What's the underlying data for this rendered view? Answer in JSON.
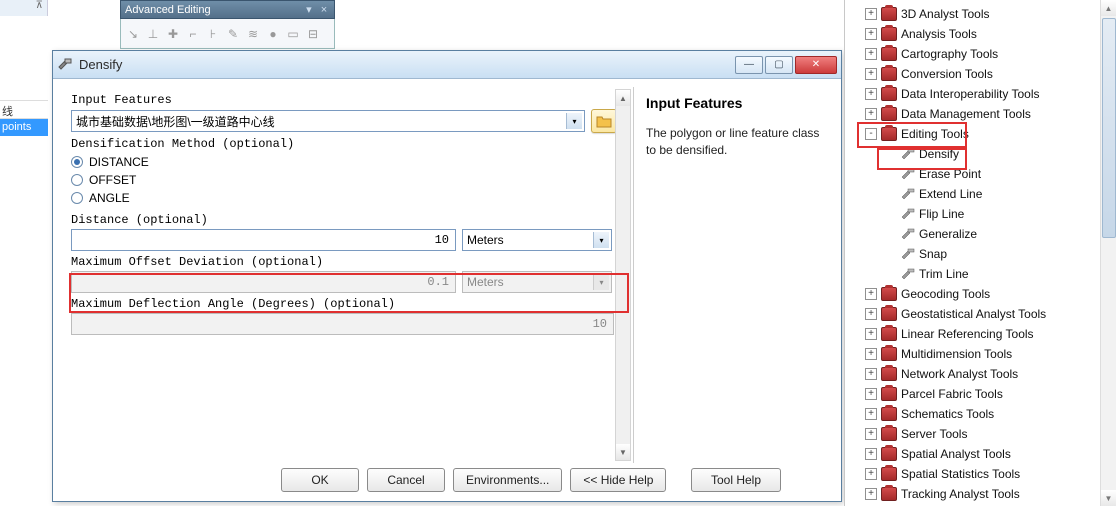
{
  "frag_top": {
    "pin": "⊼"
  },
  "adv_toolbar": {
    "title": "Advanced Editing",
    "dropdown": "▾",
    "close": "×"
  },
  "left_strip": {
    "item1": "线",
    "item2": "points"
  },
  "dialog": {
    "title": "Densify",
    "min": "—",
    "max": "▢",
    "close": "✕",
    "labels": {
      "input_features": "Input Features",
      "method": "Densification Method (optional)",
      "distance": "Distance (optional)",
      "offset": "Maximum Offset Deviation (optional)",
      "angle": "Maximum Deflection Angle (Degrees) (optional)"
    },
    "features_value": "城市基础数据\\地形图\\一级道路中心线",
    "radios": {
      "distance": "DISTANCE",
      "offset": "OFFSET",
      "angle": "ANGLE"
    },
    "values": {
      "distance": "10",
      "distance_unit": "Meters",
      "offset": "0.1",
      "offset_unit": "Meters",
      "angle": "10"
    },
    "buttons": {
      "ok": "OK",
      "cancel": "Cancel",
      "env": "Environments...",
      "hide": "<< Hide Help",
      "toolhelp": "Tool Help"
    },
    "help": {
      "title": "Input Features",
      "body": "The polygon or line feature class to be densified."
    },
    "arrow": "▾",
    "scroll_up": "▲",
    "scroll_down": "▼"
  },
  "tree": {
    "items": [
      {
        "level": 1,
        "exp": "+",
        "type": "box",
        "label": "3D Analyst Tools"
      },
      {
        "level": 1,
        "exp": "+",
        "type": "box",
        "label": "Analysis Tools"
      },
      {
        "level": 1,
        "exp": "+",
        "type": "box",
        "label": "Cartography Tools"
      },
      {
        "level": 1,
        "exp": "+",
        "type": "box",
        "label": "Conversion Tools"
      },
      {
        "level": 1,
        "exp": "+",
        "type": "box",
        "label": "Data Interoperability Tools"
      },
      {
        "level": 1,
        "exp": "+",
        "type": "box",
        "label": "Data Management Tools"
      },
      {
        "level": 1,
        "exp": "-",
        "type": "box",
        "label": "Editing Tools"
      },
      {
        "level": 2,
        "exp": "",
        "type": "ham",
        "label": "Densify"
      },
      {
        "level": 2,
        "exp": "",
        "type": "ham",
        "label": "Erase Point"
      },
      {
        "level": 2,
        "exp": "",
        "type": "ham",
        "label": "Extend Line"
      },
      {
        "level": 2,
        "exp": "",
        "type": "ham",
        "label": "Flip Line"
      },
      {
        "level": 2,
        "exp": "",
        "type": "ham",
        "label": "Generalize"
      },
      {
        "level": 2,
        "exp": "",
        "type": "ham",
        "label": "Snap"
      },
      {
        "level": 2,
        "exp": "",
        "type": "ham",
        "label": "Trim Line"
      },
      {
        "level": 1,
        "exp": "+",
        "type": "box",
        "label": "Geocoding Tools"
      },
      {
        "level": 1,
        "exp": "+",
        "type": "box",
        "label": "Geostatistical Analyst Tools"
      },
      {
        "level": 1,
        "exp": "+",
        "type": "box",
        "label": "Linear Referencing Tools"
      },
      {
        "level": 1,
        "exp": "+",
        "type": "box",
        "label": "Multidimension Tools"
      },
      {
        "level": 1,
        "exp": "+",
        "type": "box",
        "label": "Network Analyst Tools"
      },
      {
        "level": 1,
        "exp": "+",
        "type": "box",
        "label": "Parcel Fabric Tools"
      },
      {
        "level": 1,
        "exp": "+",
        "type": "box",
        "label": "Schematics Tools"
      },
      {
        "level": 1,
        "exp": "+",
        "type": "box",
        "label": "Server Tools"
      },
      {
        "level": 1,
        "exp": "+",
        "type": "box",
        "label": "Spatial Analyst Tools"
      },
      {
        "level": 1,
        "exp": "+",
        "type": "box",
        "label": "Spatial Statistics Tools"
      },
      {
        "level": 1,
        "exp": "+",
        "type": "box",
        "label": "Tracking Analyst Tools"
      }
    ],
    "scroll_up": "▲",
    "scroll_down": "▼"
  }
}
